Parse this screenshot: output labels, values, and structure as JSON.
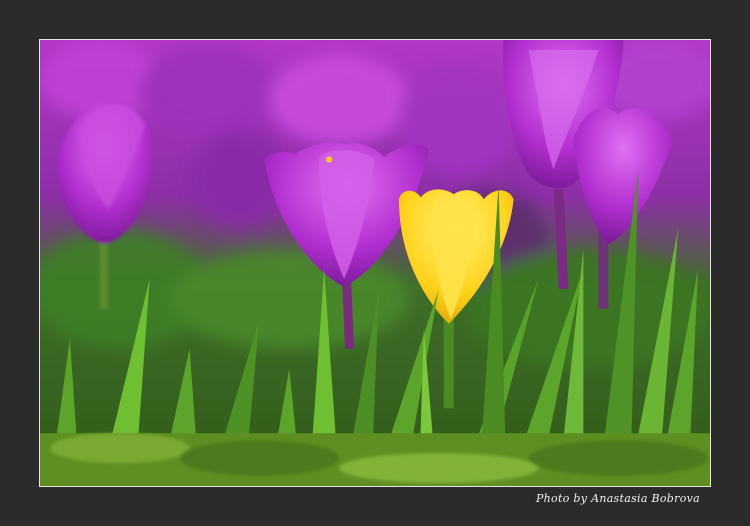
{
  "credit": {
    "text": "Photo by Anastasia Bobrova"
  },
  "photo": {
    "subject": "crocus-flowers",
    "colors": {
      "frame_background": "#2b2b2b",
      "frame_border": "#e6e6e6",
      "crocus_purple": "#b42ad0",
      "crocus_yellow": "#ffd21a",
      "grass_green": "#4f8f24"
    }
  }
}
